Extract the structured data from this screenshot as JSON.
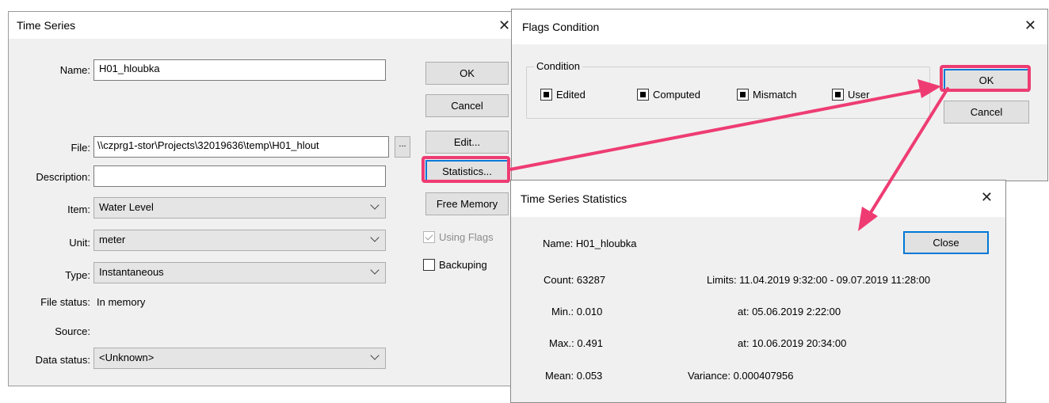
{
  "time_series": {
    "title": "Time Series",
    "name_label": "Name:",
    "name_value": "H01_hloubka",
    "file_label": "File:",
    "file_value": "\\\\czprg1-stor\\Projects\\32019636\\temp\\H01_hlout",
    "browse_label": "...",
    "description_label": "Description:",
    "description_value": "",
    "item_label": "Item:",
    "item_value": "Water Level",
    "unit_label": "Unit:",
    "unit_value": "meter",
    "type_label": "Type:",
    "type_value": "Instantaneous",
    "file_status_label": "File status:",
    "file_status_value": "In memory",
    "source_label": "Source:",
    "source_value": "",
    "data_status_label": "Data status:",
    "data_status_value": "<Unknown>",
    "ok_label": "OK",
    "cancel_label": "Cancel",
    "edit_label": "Edit...",
    "statistics_label": "Statistics...",
    "free_memory_label": "Free Memory",
    "using_flags_label": "Using Flags",
    "backuping_label": "Backuping"
  },
  "flags_condition": {
    "title": "Flags Condition",
    "group_label": "Condition",
    "edited_label": "Edited",
    "computed_label": "Computed",
    "mismatch_label": "Mismatch",
    "user_label": "User",
    "ok_label": "OK",
    "cancel_label": "Cancel"
  },
  "statistics": {
    "title": "Time Series Statistics",
    "name_text": "Name: H01_hloubka",
    "close_label": "Close",
    "count_text": "Count: 63287",
    "limits_text": "Limits: 11.04.2019 9:32:00 - 09.07.2019 11:28:00",
    "min_text": "Min.: 0.010",
    "min_at_text": "at: 05.06.2019 2:22:00",
    "max_text": "Max.: 0.491",
    "max_at_text": "at: 10.06.2019 20:34:00",
    "mean_text": "Mean: 0.053",
    "variance_text": "Variance: 0.000407956"
  },
  "colors": {
    "highlight": "#ee3c73",
    "focus": "#0078d7"
  }
}
